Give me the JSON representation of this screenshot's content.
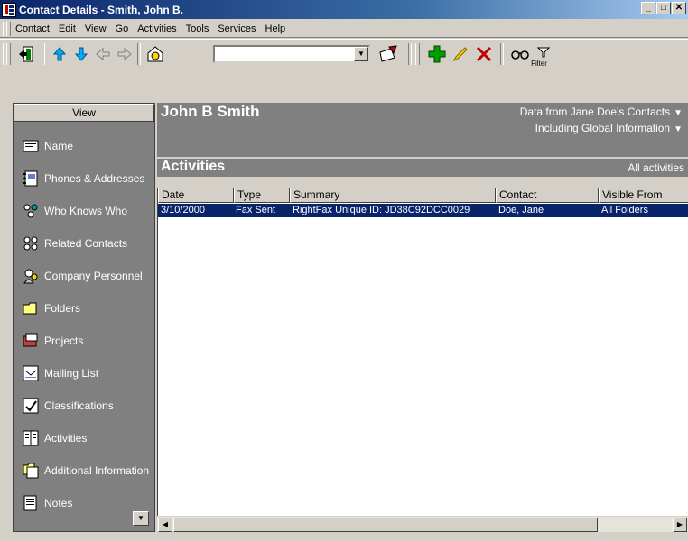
{
  "window": {
    "title": "Contact Details - Smith, John B."
  },
  "menu": [
    "Contact",
    "Edit",
    "View",
    "Go",
    "Activities",
    "Tools",
    "Services",
    "Help"
  ],
  "toolbar": {
    "search_value": "",
    "filter_label": "Filter"
  },
  "view_panel": {
    "header": "View",
    "items": [
      "Name",
      "Phones & Addresses",
      "Who Knows Who",
      "Related Contacts",
      "Company Personnel",
      "Folders",
      "Projects",
      "Mailing List",
      "Classifications",
      "Activities",
      "Additional Information",
      "Notes"
    ]
  },
  "contact": {
    "name": "John B Smith",
    "data_from": "Data from Jane Doe's Contacts",
    "including": "Including Global Information"
  },
  "activities": {
    "title": "Activities",
    "filter": "All activities",
    "columns": [
      "Date",
      "Type",
      "Summary",
      "Contact",
      "Visible From"
    ],
    "rows": [
      [
        "3/10/2000",
        "Fax Sent",
        "RightFax Unique ID: JD38C92DCC0029",
        "Doe, Jane",
        "All Folders"
      ]
    ]
  },
  "colors": {
    "title_bar": "#0a246a",
    "panel": "#808080",
    "selection": "#0a246a",
    "face": "#d4d0c8"
  }
}
